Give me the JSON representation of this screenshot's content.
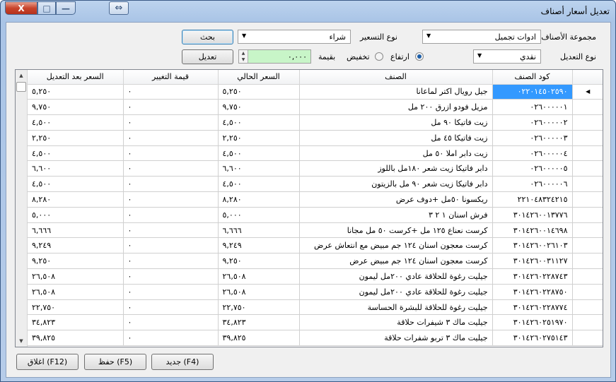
{
  "window": {
    "title": "تعديل أسعار أصناف",
    "close_glyph": "X",
    "max_glyph": "□",
    "min_glyph": "—",
    "switch_glyph": "⇔"
  },
  "filters": {
    "group_label": "مجموعة الأصناف",
    "group_value": "ادوات تجميل",
    "pricing_type_label": "نوع التسعير",
    "pricing_type_value": "شراء",
    "search_button": "بحث",
    "adjust_type_label": "نوع التعديل",
    "adjust_type_value": "نقدي",
    "increase_label": "ارتفاع",
    "decrease_label": "تخفيض",
    "increase_selected": true,
    "amount_label": "بقيمة",
    "amount_value": "٠,٠٠٠",
    "apply_button": "تعديل"
  },
  "table": {
    "columns": [
      "كود الصنف",
      "الصنف",
      "السعر الحالي",
      "قيمة التغيير",
      "السعر بعد التعديل"
    ],
    "rows": [
      {
        "code": "٠٢٢٠١٤٥٠٢٥٩٠",
        "name": "جيل رويال اكتر لماعانا",
        "current": "٥,٢٥٠",
        "change": "٠",
        "after": "٥,٢٥٠"
      },
      {
        "code": "٠٢٦٠٠٠٠٠١",
        "name": "مزيل فودو ازرق ٢٠٠ مل",
        "current": "٩,٧٥٠",
        "change": "٠",
        "after": "٩,٧٥٠"
      },
      {
        "code": "٠٢٦٠٠٠٠٠٢",
        "name": "زيت فاتيكا ٩٠ مل",
        "current": "٤,٥٠٠",
        "change": "٠",
        "after": "٤,٥٠٠"
      },
      {
        "code": "٠٢٦٠٠٠٠٠٣",
        "name": "زيت فاتيكا ٤٥ مل",
        "current": "٢,٢٥٠",
        "change": "٠",
        "after": "٢,٢٥٠"
      },
      {
        "code": "٠٢٦٠٠٠٠٠٤",
        "name": "زيت دابر املا ٥٠ مل",
        "current": "٤,٥٠٠",
        "change": "٠",
        "after": "٤,٥٠٠"
      },
      {
        "code": "٠٢٦٠٠٠٠٠٥",
        "name": "دابر فاتيكا زيت شعر ١٨٠مل باللوز",
        "current": "٦,٦٠٠",
        "change": "٠",
        "after": "٦,٦٠٠"
      },
      {
        "code": "٠٢٦٠٠٠٠٠٦",
        "name": "دابر فاتيكا زيت شعر ٩٠ مل بالزيتون",
        "current": "٤,٥٠٠",
        "change": "٠",
        "after": "٤,٥٠٠"
      },
      {
        "code": "٢٢١٠٤٨٣٢٤٢١٥",
        "name": "ريكسونا ٥٠مل +دوف عرض",
        "current": "٨,٢٨٠",
        "change": "٠",
        "after": "٨,٢٨٠"
      },
      {
        "code": "٣٠١٤٢٦٠٠١٣٧٧٦",
        "name": "فرش اسنان ١ ٢ ٣",
        "current": "٥,٠٠٠",
        "change": "٠",
        "after": "٥,٠٠٠"
      },
      {
        "code": "٣٠١٤٢٦٠٠١٤٦٩٨",
        "name": "كرست نعناع ١٢٥ مل +كرست ٥٠ مل مجانا",
        "current": "٦,٦٦٦",
        "change": "٠",
        "after": "٦,٦٦٦"
      },
      {
        "code": "٣٠١٤٢٦٠٠٢٦١٠٣",
        "name": "كرست معجون اسنان ١٢٤ جم مبيض مع انتعاش عرض",
        "current": "٩,٢٤٩",
        "change": "٠",
        "after": "٩,٢٤٩"
      },
      {
        "code": "٣٠١٤٢٦٠٠٣١١٢٧",
        "name": "كرست معجون اسنان ١٢٤ جم مبيض عرض",
        "current": "٩,٢٥٠",
        "change": "٠",
        "after": "٩,٢٥٠"
      },
      {
        "code": "٣٠١٤٢٦٠٢٢٨٧٤٣",
        "name": "جيليت رغوة للحلاقة عادي ٢٠٠مل ليمون",
        "current": "٢٦,٥٠٨",
        "change": "٠",
        "after": "٢٦,٥٠٨"
      },
      {
        "code": "٣٠١٤٢٦٠٢٢٨٧٥٠",
        "name": "جيليت رغوة للحلاقة عادي ٢٠٠مل ليمون",
        "current": "٢٦,٥٠٨",
        "change": "٠",
        "after": "٢٦,٥٠٨"
      },
      {
        "code": "٣٠١٤٢٦٠٢٢٨٧٧٤",
        "name": "جيليت رغوة للحلاقة للبشرة الحساسة",
        "current": "٢٢,٧٥٠",
        "change": "٠",
        "after": "٢٢,٧٥٠"
      },
      {
        "code": "٣٠١٤٢٦٠٢٥١٩٧٠",
        "name": "جيليت ماك ٣ شيفرات حلاقة",
        "current": "٣٤,٨٢٣",
        "change": "٠",
        "after": "٣٤,٨٢٣"
      },
      {
        "code": "٣٠١٤٢٦٠٢٧٥١٤٣",
        "name": "جيليت ماك ٣ تربو شفرات حلاقة",
        "current": "٣٩,٨٢٥",
        "change": "٠",
        "after": "٣٩,٨٢٥"
      }
    ]
  },
  "footer": {
    "new_button": "جديد (F4)",
    "save_button": "حفظ (F5)",
    "close_button": "اغلاق (F12)"
  },
  "colors": {
    "selection": "#3399ff",
    "amount_field": "#c8f5c8",
    "title_gradient": "#a9c4e6"
  }
}
